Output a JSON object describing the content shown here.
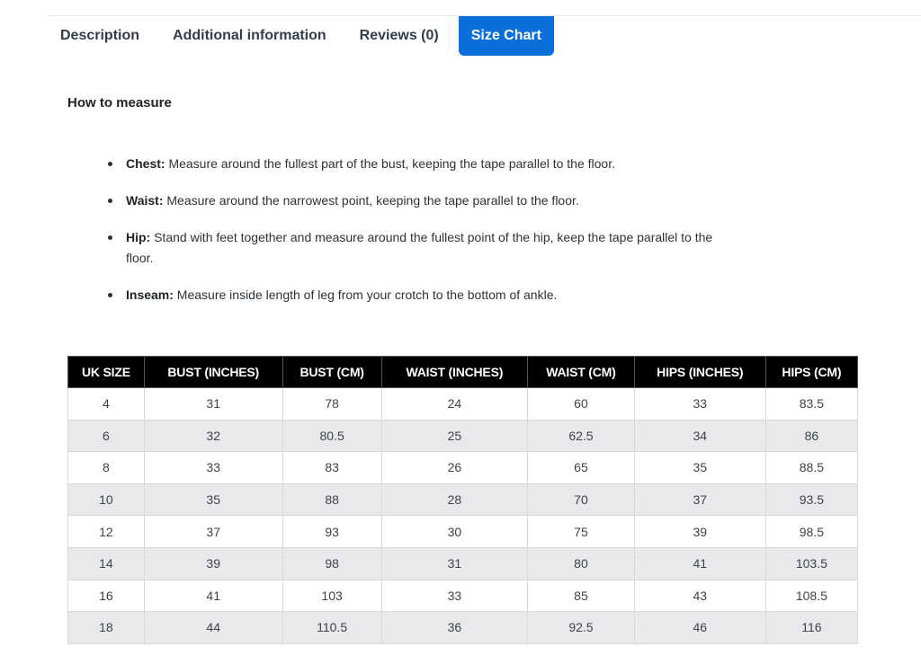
{
  "tabs": [
    {
      "label": "Description",
      "active": false
    },
    {
      "label": "Additional information",
      "active": false
    },
    {
      "label": "Reviews (0)",
      "active": false
    },
    {
      "label": "Size Chart",
      "active": true
    }
  ],
  "colors": {
    "accent": "#0a6fdb",
    "table_header_bg": "#000000",
    "row_alt_bg": "#e9e9ec"
  },
  "section": {
    "heading": "How to measure",
    "items": [
      {
        "term": "Chest:",
        "text": " Measure around the fullest part of the bust, keeping the tape parallel to the floor."
      },
      {
        "term": "Waist:",
        "text": " Measure around the narrowest point, keeping the tape parallel to the floor."
      },
      {
        "term": "Hip:",
        "text": " Stand with feet together and measure around the fullest point of the hip, keep the tape parallel to the floor."
      },
      {
        "term": "Inseam:",
        "text": " Measure inside length of leg from your crotch to the bottom of ankle."
      }
    ]
  },
  "table": {
    "headers": [
      "UK SIZE",
      "BUST (INCHES)",
      "BUST (CM)",
      "WAIST (INCHES)",
      "WAIST (CM)",
      "HIPS (INCHES)",
      "HIPS (CM)"
    ],
    "rows": [
      [
        "4",
        "31",
        "78",
        "24",
        "60",
        "33",
        "83.5"
      ],
      [
        "6",
        "32",
        "80.5",
        "25",
        "62.5",
        "34",
        "86"
      ],
      [
        "8",
        "33",
        "83",
        "26",
        "65",
        "35",
        "88.5"
      ],
      [
        "10",
        "35",
        "88",
        "28",
        "70",
        "37",
        "93.5"
      ],
      [
        "12",
        "37",
        "93",
        "30",
        "75",
        "39",
        "98.5"
      ],
      [
        "14",
        "39",
        "98",
        "31",
        "80",
        "41",
        "103.5"
      ],
      [
        "16",
        "41",
        "103",
        "33",
        "85",
        "43",
        "108.5"
      ],
      [
        "18",
        "44",
        "110.5",
        "36",
        "92.5",
        "46",
        "116"
      ]
    ]
  }
}
